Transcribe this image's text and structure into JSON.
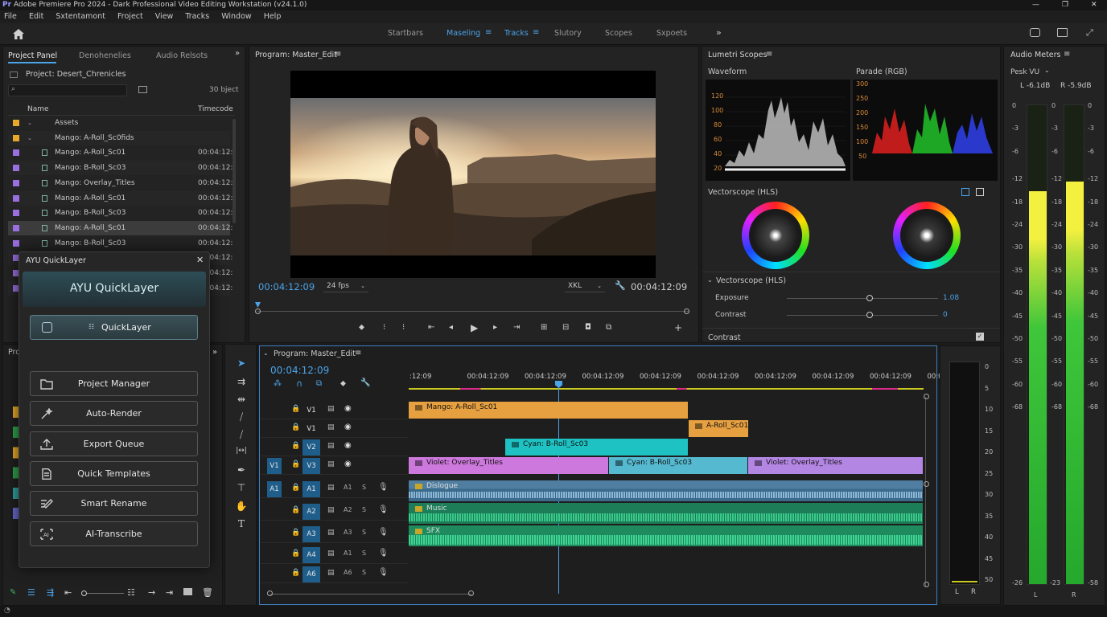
{
  "app": {
    "title": "Adobe Premiere Pro 2024 - Dark Professional Video Editing Workstation (v24.1.0)",
    "logo": "Pr"
  },
  "menu": [
    "File",
    "Edit",
    "Sxtentamont",
    "Froject",
    "View",
    "Tracks",
    "Window",
    "Help"
  ],
  "workspaces": [
    "Startbars",
    "Maseling",
    "Tracks",
    "Slutory",
    "Scopes",
    "Sxpoets"
  ],
  "project": {
    "tabs": [
      "Project Panel",
      "Denohenelies",
      "Audio Relsots"
    ],
    "name": "Project: Desert_Chrenicles",
    "count": "30 bject",
    "columns": [
      "Name",
      "Timecode"
    ],
    "rows": [
      {
        "name": "Assets",
        "tc": "",
        "color": "#e8a92a"
      },
      {
        "name": "Mango: A-Roll_Sc0fids",
        "tc": "",
        "color": "#e8a92a"
      },
      {
        "name": "Mango: A-Roll_Sc01",
        "tc": "00:04:12:",
        "color": "#9a6fe0"
      },
      {
        "name": "Mango: B-Roll_Sc03",
        "tc": "00:04:12:",
        "color": "#9a6fe0"
      },
      {
        "name": "Mango: Overlay_Titles",
        "tc": "00:04:12:",
        "color": "#9a6fe0"
      },
      {
        "name": "Mango: A-Roll_Sc01",
        "tc": "00:04:12:",
        "color": "#9a6fe0"
      },
      {
        "name": "Mango: B-Roll_Sc03",
        "tc": "00:04:12:",
        "color": "#9a6fe0"
      },
      {
        "name": "Mango: A-Roll_Sc01",
        "tc": "00:04:12:",
        "color": "#9a6fe0"
      },
      {
        "name": "Mango: B-Roll_Sc03",
        "tc": "00:04:12:",
        "color": "#9a6fe0"
      },
      {
        "name": "",
        "tc": "00:04:12:",
        "color": "#9a6fe0"
      },
      {
        "name": "",
        "tc": "00:04:12:",
        "color": "#9a6fe0"
      },
      {
        "name": "",
        "tc": "00:04:12:",
        "color": "#9a6fe0"
      }
    ],
    "second_tab": "Pro"
  },
  "quicklayer": {
    "window_title": "AYU QuickLayer",
    "heading": "AYU QuickLayer",
    "primary": "QuickLayer",
    "items": [
      "Project Manager",
      "Auto-Render",
      "Export Queue",
      "Quick Templates",
      "Smart Rename",
      "AI-Transcribe"
    ]
  },
  "program": {
    "title": "Program: Master_Edit",
    "timecode": "00:04:12:09",
    "fps": "24 fps",
    "quality": "XKL",
    "duration": "00:04:12:09"
  },
  "lumetri": {
    "title": "Lumetri Scopes",
    "waveform": {
      "label": "Waveform",
      "ticks": [
        "120",
        "100",
        "80",
        "60",
        "40",
        "20"
      ]
    },
    "parade": {
      "label": "Parade (RGB)",
      "ticks": [
        "300",
        "250",
        "200",
        "150",
        "100",
        "50"
      ]
    },
    "vectorscope": "Vectorscope (HLS)",
    "section": "Vectorscope (HLS)",
    "exposure": {
      "label": "Exposure",
      "value": "1.08",
      "level": 0.55
    },
    "contrast": {
      "label": "Contrast",
      "value": "0",
      "level": 0.55
    },
    "contrast2": "Contrast"
  },
  "timeline": {
    "title": "Program: Master_Edit",
    "timecode": "00:04:12:09",
    "ruler": [
      ":12:09",
      "00:04:12:09",
      "00:04:12:09",
      "00:04:12:09",
      "00:04:12:09",
      "00:04:12:09",
      "00:04:12:09",
      "00:04:12:09",
      "00:04:12:09",
      "00:0"
    ],
    "tracks": [
      {
        "src": "",
        "name": "V1",
        "kind": "v"
      },
      {
        "src": "",
        "name": "V1",
        "kind": "v"
      },
      {
        "src": "",
        "name": "V2",
        "kind": "v"
      },
      {
        "src": "V1",
        "name": "V3",
        "kind": "v"
      },
      {
        "src": "A1",
        "name": "A1",
        "sub": "A1",
        "kind": "a"
      },
      {
        "src": "",
        "name": "A2",
        "sub": "A2",
        "kind": "a"
      },
      {
        "src": "",
        "name": "A3",
        "sub": "A3",
        "kind": "a"
      },
      {
        "src": "",
        "name": "A4",
        "sub": "A1",
        "kind": "a"
      },
      {
        "src": "",
        "name": "A6",
        "sub": "A6",
        "kind": "a"
      }
    ],
    "solo": "S",
    "clips": {
      "c1": "Mango: A-Roll_Sc01",
      "c2": "A-Roll_Sc01",
      "c3": "Cyan: B-Roll_Sc03",
      "c4": "Violet: Overlay_Titles",
      "c5": "Cyan: B-Roll_Sc03",
      "c6": "Violet: Overlay_Titles",
      "a1": "Dislogue",
      "a2": "Music",
      "a3": "SFX"
    }
  },
  "small_meter": {
    "ticks": [
      "0",
      "5",
      "10",
      "15",
      "20",
      "25",
      "30",
      "35",
      "40",
      "45",
      "50"
    ],
    "labels": [
      "L",
      "R"
    ]
  },
  "audio_meters": {
    "title": "Audio Meters",
    "mode": "Pesk VU",
    "left_val": "L -6.1dB",
    "right_val": "R -5.9dB",
    "ticks": [
      "0",
      "-3",
      "-6",
      "-12",
      "-18",
      "-24",
      "-30",
      "-35",
      "-40",
      "-45",
      "-50",
      "-55",
      "-60",
      "-68"
    ],
    "bottom_left": "-26",
    "bottom_right": "-58",
    "bottom_mid": "-23",
    "channels": [
      "L",
      "R"
    ],
    "left_level": 0.82,
    "right_level": 0.84
  }
}
